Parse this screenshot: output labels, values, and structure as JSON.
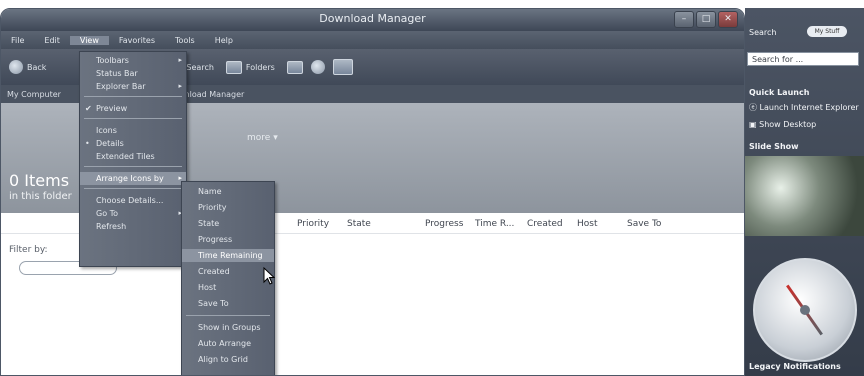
{
  "window": {
    "title": "Download Manager",
    "min_label": "–",
    "max_label": "□",
    "close_label": "✕"
  },
  "menubar": {
    "items": [
      "File",
      "Edit",
      "View",
      "Favorites",
      "Tools",
      "Help"
    ]
  },
  "toolbar": {
    "back_label": "Back",
    "search_label": "Search",
    "folders_label": "Folders"
  },
  "address": {
    "crumb1": "My Computer",
    "crumb2": "Download Manager"
  },
  "header": {
    "count": "0 Items",
    "sub": "in this folder",
    "more": "more"
  },
  "columns": [
    "Priority",
    "State",
    "Progress",
    "Time R...",
    "Created",
    "Host",
    "Save To"
  ],
  "filter": {
    "label": "Filter by:",
    "value": ""
  },
  "view_menu": [
    {
      "label": "Toolbars",
      "sub": "▸"
    },
    {
      "label": "Status Bar"
    },
    {
      "label": "Explorer Bar",
      "sub": "▸"
    },
    {
      "label": "Preview",
      "check": "✔"
    },
    {
      "label": "Icons"
    },
    {
      "label": "Details",
      "check": "•"
    },
    {
      "label": "Extended Tiles"
    },
    {
      "label": "Arrange Icons by",
      "sub": "▸"
    },
    {
      "label": "Choose Details..."
    },
    {
      "label": "Go To",
      "sub": "▸"
    },
    {
      "label": "Refresh"
    }
  ],
  "arrange_menu": [
    "Name",
    "Priority",
    "State",
    "Progress",
    "Time Remaining",
    "Created",
    "Host",
    "Save To",
    "Show in Groups",
    "Auto Arrange",
    "Align to Grid"
  ],
  "sidebar": {
    "search_title": "Search",
    "mystuff": "My Stuff",
    "search_placeholder": "Search for ...",
    "quick_launch": "Quick Launch",
    "launch_ie": "Launch Internet Explorer",
    "show_desktop": "Show Desktop",
    "slideshow": "Slide Show",
    "legacy": "Legacy Notifications"
  }
}
